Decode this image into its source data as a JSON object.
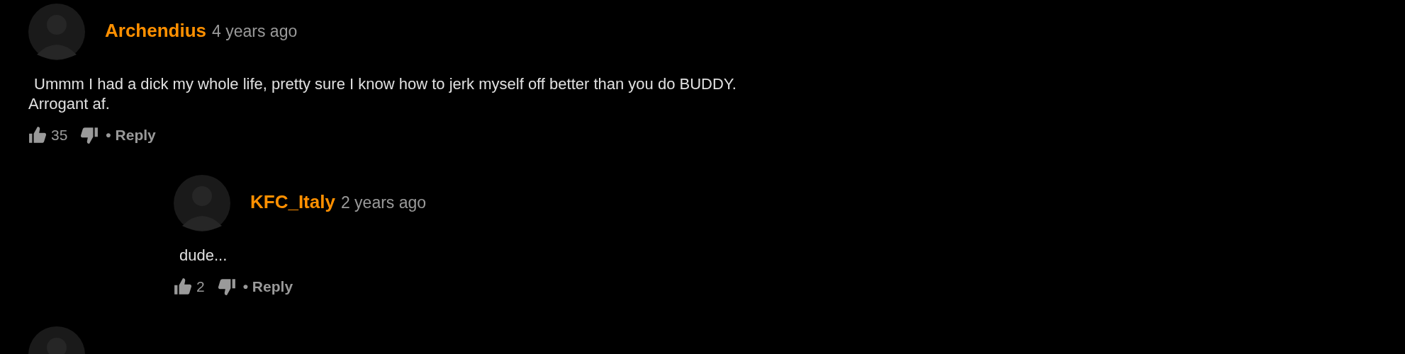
{
  "comments": [
    {
      "author": "Archendius",
      "time": "4 years ago",
      "lines": [
        "Ummm I had a dick my whole life, pretty sure I know how to jerk myself off better than you do BUDDY.",
        "Arrogant af."
      ],
      "likes": "35",
      "reply": "• Reply",
      "replies": [
        {
          "author": "KFC_Italy",
          "time": "2 years ago",
          "lines": [
            "dude..."
          ],
          "likes": "2",
          "reply": "• Reply"
        }
      ]
    }
  ]
}
